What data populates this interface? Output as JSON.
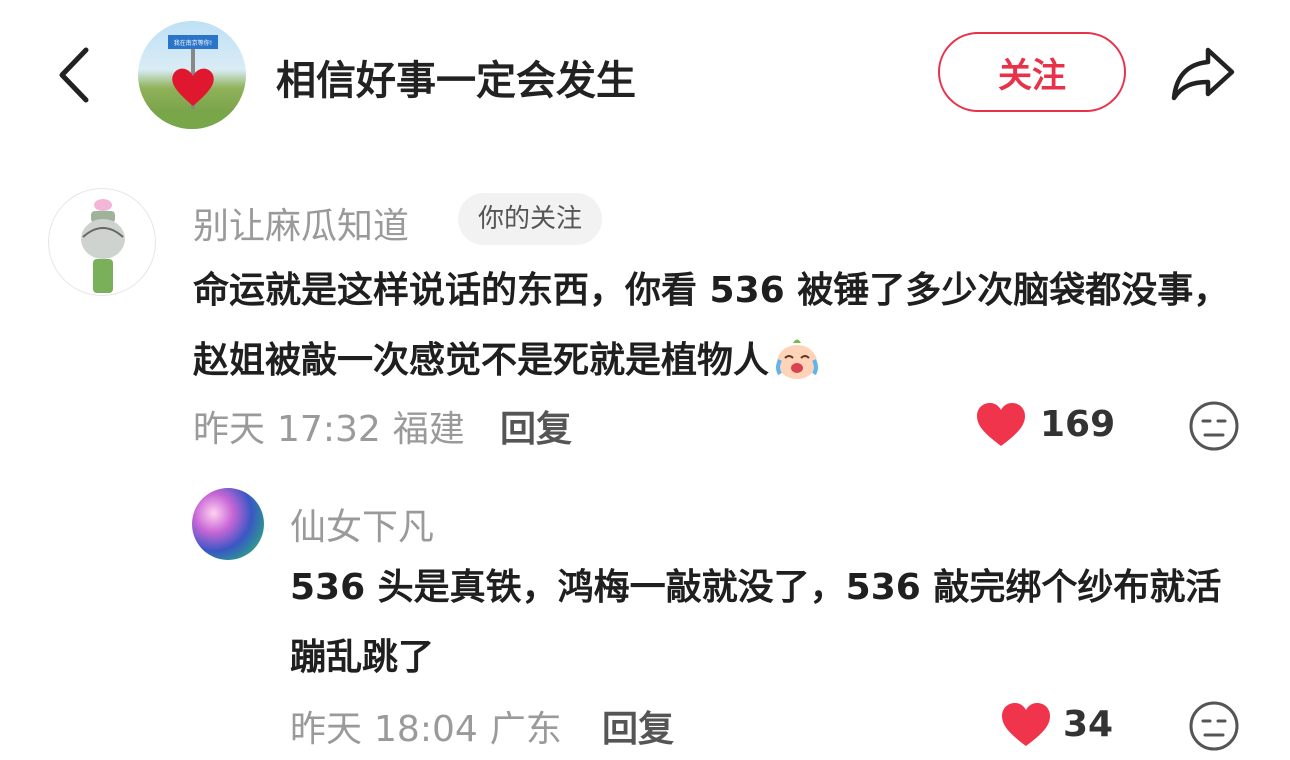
{
  "header": {
    "author_name": "相信好事一定会发生",
    "avatar_sign_text": "我在南京等你!",
    "follow_label": "关注"
  },
  "comments": [
    {
      "username": "别让麻瓜知道",
      "badge": "你的关注",
      "text": "命运就是这样说话的东西，你看 536 被锤了多少次脑袋都没事，赵姐被敲一次感觉不是死就是植物人",
      "emoji": "crying-laughing-emoji",
      "date": "昨天",
      "time": "17:32",
      "location": "福建",
      "reply_label": "回复",
      "likes": "169",
      "replies": [
        {
          "username": "仙女下凡",
          "text": "536 头是真铁，鸿梅一敲就没了，536 敲完绑个纱布就活蹦乱跳了",
          "date": "昨天",
          "time": "18:04",
          "location": "广东",
          "reply_label": "回复",
          "likes": "34"
        }
      ]
    }
  ],
  "colors": {
    "accent": "#e8324a",
    "like": "#f0344b",
    "muted": "#9a9a9a"
  },
  "icons": [
    "back-arrow-icon",
    "share-icon",
    "heart-icon",
    "emoji-reaction-icon"
  ]
}
